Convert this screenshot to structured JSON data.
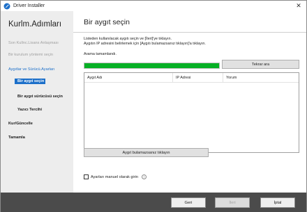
{
  "window": {
    "title": "Driver Installer",
    "close_glyph": "✕"
  },
  "sidebar": {
    "heading": "Kurlm.Adımları",
    "steps": [
      {
        "label": "Son Kullnc.Lisans Anlaşması",
        "state": "done"
      },
      {
        "label": "Bir kurulum yöntemi seçin",
        "state": "done"
      },
      {
        "label": "Aygıtlar ve Sürücü.Ayarları",
        "state": "active-section"
      },
      {
        "label": "Bir aygıt seçin",
        "state": "current"
      },
      {
        "label": "Bir aygıt sürücüsü seçin",
        "state": "pending"
      },
      {
        "label": "Yazıcı Tercihi",
        "state": "pending"
      },
      {
        "label": "Kur/Güncelle",
        "state": "pending"
      },
      {
        "label": "Tamamla",
        "state": "pending"
      }
    ]
  },
  "main": {
    "title": "Bir aygıt seçin",
    "instructions": [
      "Listeden kullanılacak aygıtı seçin ve [İleri]'ye tıklayın.",
      "Aygıtın IP adresini belirlemek için [Aygıtı bulamazsanız tıklayın]'a tıklayın."
    ],
    "search_status": "Arama tamamlandı.",
    "progress_percent": 100,
    "search_again_button": "Tekrar ara",
    "device_list": {
      "columns": [
        "Aygıt Adı",
        "IP Adresi",
        "Yorum"
      ],
      "rows": []
    },
    "not_found_button": "Aygıt bulamazsanız tıklayın",
    "manual_settings": {
      "label": "Ayarları manuel olarak girin",
      "checked": false,
      "info_glyph": "i"
    }
  },
  "footer": {
    "back_button": "Geri",
    "next_button": "İleri",
    "cancel_button": "İptal"
  },
  "colors": {
    "accent": "#1c6fc9",
    "progress": "#06b025",
    "footer": "#4b4b4b",
    "sidebar": "#ededed"
  }
}
